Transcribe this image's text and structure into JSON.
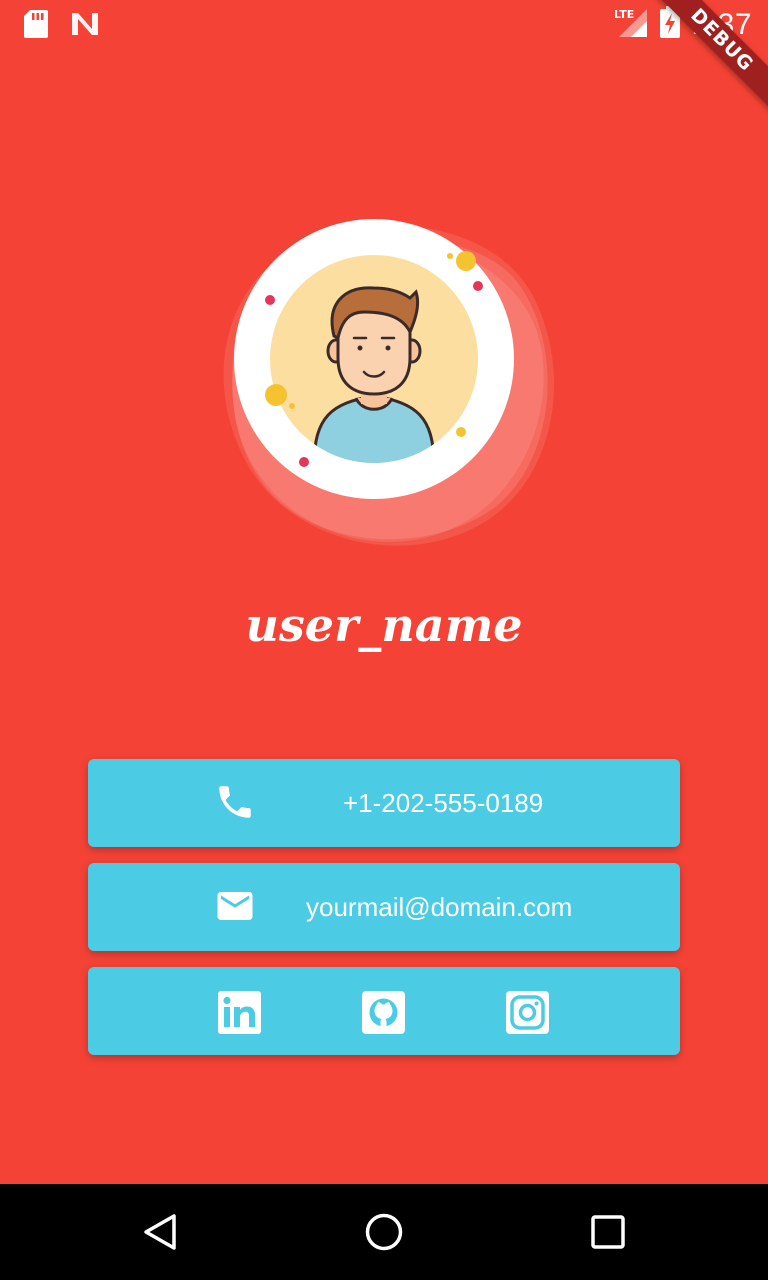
{
  "status_bar": {
    "time": "1:37",
    "network": "LTE",
    "icons": [
      "sd-card-icon",
      "n-logo-icon",
      "lte-signal-icon",
      "battery-charging-icon"
    ]
  },
  "debug_banner": "DEBUG",
  "profile": {
    "user_name": "user_name",
    "avatar": "avatar-illustration"
  },
  "contacts": {
    "phone": {
      "icon": "phone-icon",
      "value": "+1-202-555-0189"
    },
    "email": {
      "icon": "email-icon",
      "value": "yourmail@domain.com"
    }
  },
  "social": {
    "icons": [
      "linkedin-icon",
      "github-icon",
      "instagram-icon"
    ]
  },
  "nav_bar": {
    "buttons": [
      "back-icon",
      "home-icon",
      "recents-icon"
    ]
  },
  "colors": {
    "background": "#F44336",
    "card": "#4BCBE4",
    "text": "#FFFFFF",
    "nav": "#000000"
  }
}
